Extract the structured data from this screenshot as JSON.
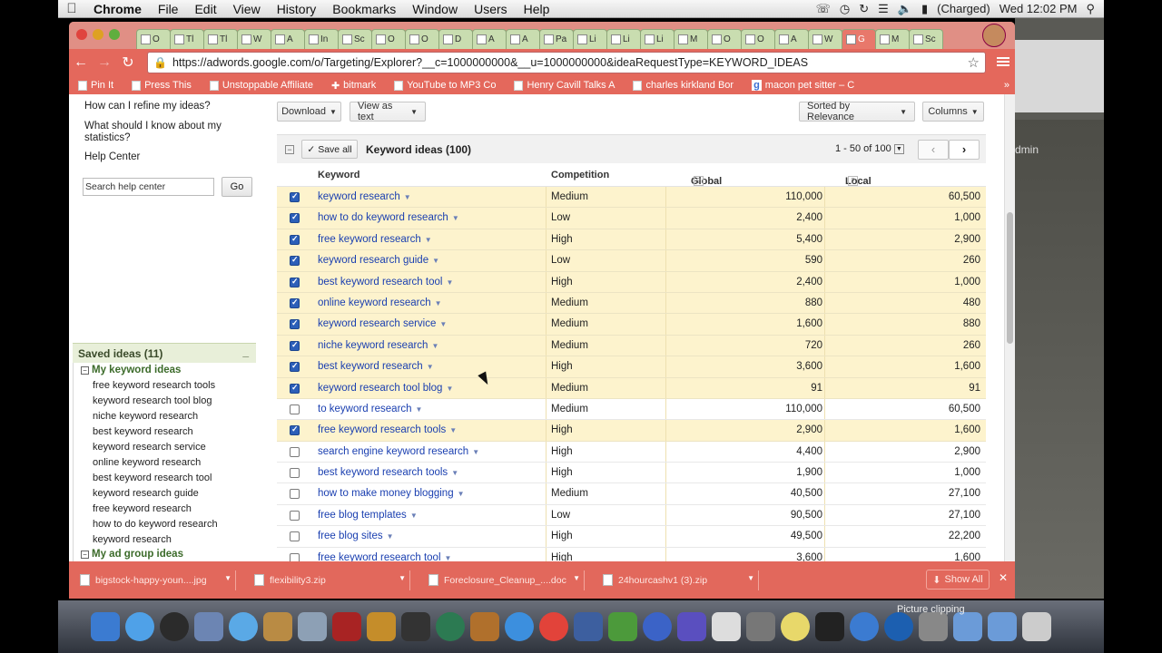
{
  "menubar": {
    "app": "Chrome",
    "items": [
      "File",
      "Edit",
      "View",
      "History",
      "Bookmarks",
      "Window",
      "Users",
      "Help"
    ],
    "battery": "(Charged)",
    "clock": "Wed 12:02 PM"
  },
  "browser": {
    "tabs": [
      "O",
      "Tl",
      "Tl",
      "W",
      "A",
      "In",
      "Sc",
      "O",
      "O",
      "D",
      "A",
      "A",
      "Pa",
      "Li",
      "Li",
      "Li",
      "M",
      "O",
      "O",
      "A",
      "W",
      "G",
      "M",
      "Sc"
    ],
    "url": "https://adwords.google.com/o/Targeting/Explorer?__c=1000000000&__u=1000000000&ideaRequestType=KEYWORD_IDEAS",
    "bookmarks": [
      "Pin It",
      "Press This",
      "Unstoppable Affiliate",
      "bitmark",
      "YouTube to MP3 Co",
      "Henry Cavill Talks A",
      "charles kirkland Bor",
      "macon pet sitter – C"
    ]
  },
  "help": {
    "links": [
      "How can I refine my ideas?",
      "What should I know about my statistics?",
      "Help Center"
    ],
    "search_placeholder": "Search help center",
    "go_label": "Go"
  },
  "saved": {
    "title": "Saved ideas (11)",
    "group1": "My keyword ideas",
    "items": [
      "free keyword research tools",
      "keyword research tool blog",
      "niche keyword research",
      "best keyword research",
      "keyword research service",
      "online keyword research",
      "best keyword research tool",
      "keyword research guide",
      "free keyword research",
      "how to do keyword research",
      "keyword research"
    ],
    "group2": "My ad group ideas"
  },
  "toolbar": {
    "download": "Download",
    "view_as_text": "View as text",
    "sorted": "Sorted by Relevance",
    "columns": "Columns"
  },
  "table": {
    "save_all": "Save all",
    "title": "Keyword ideas (100)",
    "pager": "1 - 50 of 100",
    "headers": [
      "Keyword",
      "Competition",
      "Global Monthly Searches",
      "Local Monthly Searches"
    ],
    "rows": [
      {
        "kw": "keyword research",
        "comp": "Medium",
        "gms": "110,000",
        "lms": "60,500",
        "sel": true
      },
      {
        "kw": "how to do keyword research",
        "comp": "Low",
        "gms": "2,400",
        "lms": "1,000",
        "sel": true
      },
      {
        "kw": "free keyword research",
        "comp": "High",
        "gms": "5,400",
        "lms": "2,900",
        "sel": true
      },
      {
        "kw": "keyword research guide",
        "comp": "Low",
        "gms": "590",
        "lms": "260",
        "sel": true
      },
      {
        "kw": "best keyword research tool",
        "comp": "High",
        "gms": "2,400",
        "lms": "1,000",
        "sel": true
      },
      {
        "kw": "online keyword research",
        "comp": "Medium",
        "gms": "880",
        "lms": "480",
        "sel": true
      },
      {
        "kw": "keyword research service",
        "comp": "Medium",
        "gms": "1,600",
        "lms": "880",
        "sel": true
      },
      {
        "kw": "niche keyword research",
        "comp": "Medium",
        "gms": "720",
        "lms": "260",
        "sel": true
      },
      {
        "kw": "best keyword research",
        "comp": "High",
        "gms": "3,600",
        "lms": "1,600",
        "sel": true
      },
      {
        "kw": "keyword research tool blog",
        "comp": "Medium",
        "gms": "91",
        "lms": "91",
        "sel": true
      },
      {
        "kw": "to keyword research",
        "comp": "Medium",
        "gms": "110,000",
        "lms": "60,500",
        "sel": false
      },
      {
        "kw": "free keyword research tools",
        "comp": "High",
        "gms": "2,900",
        "lms": "1,600",
        "sel": true
      },
      {
        "kw": "search engine keyword research",
        "comp": "High",
        "gms": "4,400",
        "lms": "2,900",
        "sel": false
      },
      {
        "kw": "best keyword research tools",
        "comp": "High",
        "gms": "1,900",
        "lms": "1,000",
        "sel": false
      },
      {
        "kw": "how to make money blogging",
        "comp": "Medium",
        "gms": "40,500",
        "lms": "27,100",
        "sel": false
      },
      {
        "kw": "free blog templates",
        "comp": "Low",
        "gms": "90,500",
        "lms": "27,100",
        "sel": false
      },
      {
        "kw": "free blog sites",
        "comp": "High",
        "gms": "49,500",
        "lms": "22,200",
        "sel": false
      },
      {
        "kw": "free keyword research tool",
        "comp": "High",
        "gms": "3,600",
        "lms": "1,600",
        "sel": false
      }
    ]
  },
  "downloads": {
    "files": [
      "bigstock-happy-youn....jpg",
      "flexibility3.zip",
      "Foreclosure_Cleanup_....doc",
      "24hourcashv1 (3).zip"
    ],
    "show_all": "Show All"
  },
  "desktop": {
    "partial_label": "dmin",
    "picture_clipping": "Picture clipping"
  },
  "colors": {
    "chrome_theme": "#e4685c",
    "selected_row": "#fdf3cd",
    "link": "#1a3fb0",
    "group_green": "#3c6b2a"
  }
}
